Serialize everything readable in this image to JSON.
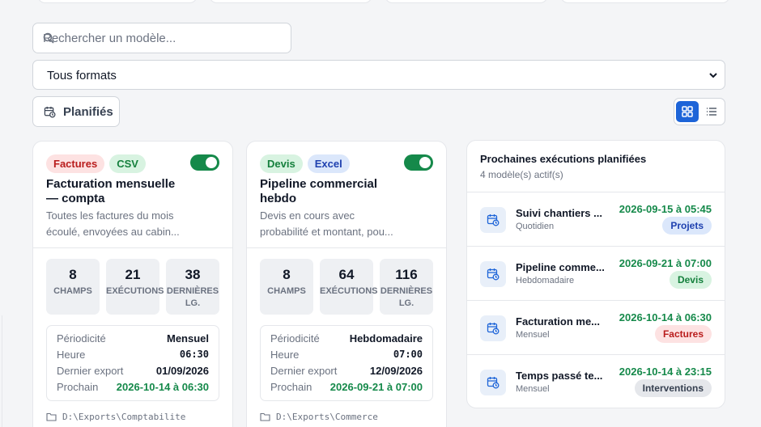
{
  "search": {
    "placeholder": "Rechercher un modèle..."
  },
  "format_filter": {
    "selected": "Tous formats"
  },
  "scheduled_filter": {
    "label": "Planifiés"
  },
  "cards": [
    {
      "tags": [
        "Factures",
        "CSV"
      ],
      "enabled": true,
      "title": "Facturation mensuelle — compta",
      "description": "Toutes les factures du mois écoulé, envoyées au cabin...",
      "stats": [
        {
          "value": "8",
          "label": "CHAMPS"
        },
        {
          "value": "21",
          "label": "EXÉCUTIONS"
        },
        {
          "value": "38",
          "label": "DERNIÈRES LG."
        }
      ],
      "details": [
        {
          "key": "Périodicité",
          "value": "Mensuel"
        },
        {
          "key": "Heure",
          "value": "06:30"
        },
        {
          "key": "Dernier export",
          "value": "01/09/2026"
        },
        {
          "key": "Prochain",
          "value": "2026-10-14 à 06:30"
        }
      ],
      "path": "D:\\Exports\\Comptabilite"
    },
    {
      "tags": [
        "Devis",
        "Excel"
      ],
      "enabled": true,
      "title": "Pipeline commercial hebdo",
      "description": "Devis en cours avec probabilité et montant, pou...",
      "stats": [
        {
          "value": "8",
          "label": "CHAMPS"
        },
        {
          "value": "64",
          "label": "EXÉCUTIONS"
        },
        {
          "value": "116",
          "label": "DERNIÈRES LG."
        }
      ],
      "details": [
        {
          "key": "Périodicité",
          "value": "Hebdomadaire"
        },
        {
          "key": "Heure",
          "value": "07:00"
        },
        {
          "key": "Dernier export",
          "value": "12/09/2026"
        },
        {
          "key": "Prochain",
          "value": "2026-09-21 à 07:00"
        }
      ],
      "path": "D:\\Exports\\Commerce"
    }
  ],
  "upcoming": {
    "title": "Prochaines exécutions planifiées",
    "subtitle": "4 modèle(s) actif(s)",
    "items": [
      {
        "name": "Suivi chantiers ...",
        "frequency": "Quotidien",
        "when": "2026-09-15 à 05:45",
        "category": "Projets"
      },
      {
        "name": "Pipeline comme...",
        "frequency": "Hebdomadaire",
        "when": "2026-09-21 à 07:00",
        "category": "Devis"
      },
      {
        "name": "Facturation me...",
        "frequency": "Mensuel",
        "when": "2026-10-14 à 06:30",
        "category": "Factures"
      },
      {
        "name": "Temps passé te...",
        "frequency": "Mensuel",
        "when": "2026-10-14 à 23:15",
        "category": "Interventions"
      }
    ]
  },
  "icons": {
    "search": "search-icon",
    "calendar": "calendar-clock-icon",
    "grid_view": "grid-view-icon",
    "list_view": "list-view-icon",
    "folder": "folder-icon",
    "chevron": "chevron-down-icon"
  },
  "colors": {
    "accent": "#1d64d8",
    "success": "#15894a",
    "danger": "#b91c1c"
  }
}
